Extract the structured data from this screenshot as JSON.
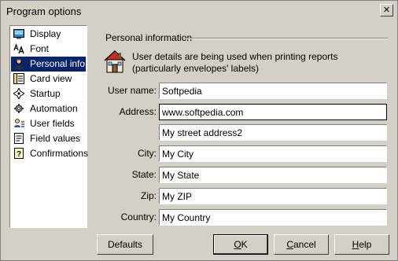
{
  "window": {
    "title": "Program options",
    "close_glyph": "✕"
  },
  "nav": {
    "items": [
      {
        "label": "Display",
        "icon": "display-icon",
        "selected": false
      },
      {
        "label": "Font",
        "icon": "font-icon",
        "selected": false
      },
      {
        "label": "Personal info",
        "icon": "person-icon",
        "selected": true
      },
      {
        "label": "Card view",
        "icon": "card-view-icon",
        "selected": false
      },
      {
        "label": "Startup",
        "icon": "startup-icon",
        "selected": false
      },
      {
        "label": "Automation",
        "icon": "automation-icon",
        "selected": false
      },
      {
        "label": "User fields",
        "icon": "user-fields-icon",
        "selected": false
      },
      {
        "label": "Field values",
        "icon": "field-values-icon",
        "selected": false
      },
      {
        "label": "Confirmations",
        "icon": "confirmations-icon",
        "selected": false
      }
    ]
  },
  "section": {
    "title": "Personal information",
    "description": "User details are being used when printing reports (particularly envelopes' labels)"
  },
  "fields": {
    "user_name": {
      "label": "User name:",
      "value": "Softpedia"
    },
    "address": {
      "label": "Address:",
      "value": "www.softpedia.com"
    },
    "address2": {
      "value": "My street address2"
    },
    "city": {
      "label": "City:",
      "value": "My City"
    },
    "state": {
      "label": "State:",
      "value": "My State"
    },
    "zip": {
      "label": "Zip:",
      "value": "My ZIP"
    },
    "country": {
      "label": "Country:",
      "value": "My Country"
    }
  },
  "buttons": {
    "defaults": "Defaults",
    "ok_mnemonic": "O",
    "ok_rest": "K",
    "cancel_mnemonic": "C",
    "cancel_rest": "ancel",
    "help_mnemonic": "H",
    "help_rest": "elp"
  }
}
